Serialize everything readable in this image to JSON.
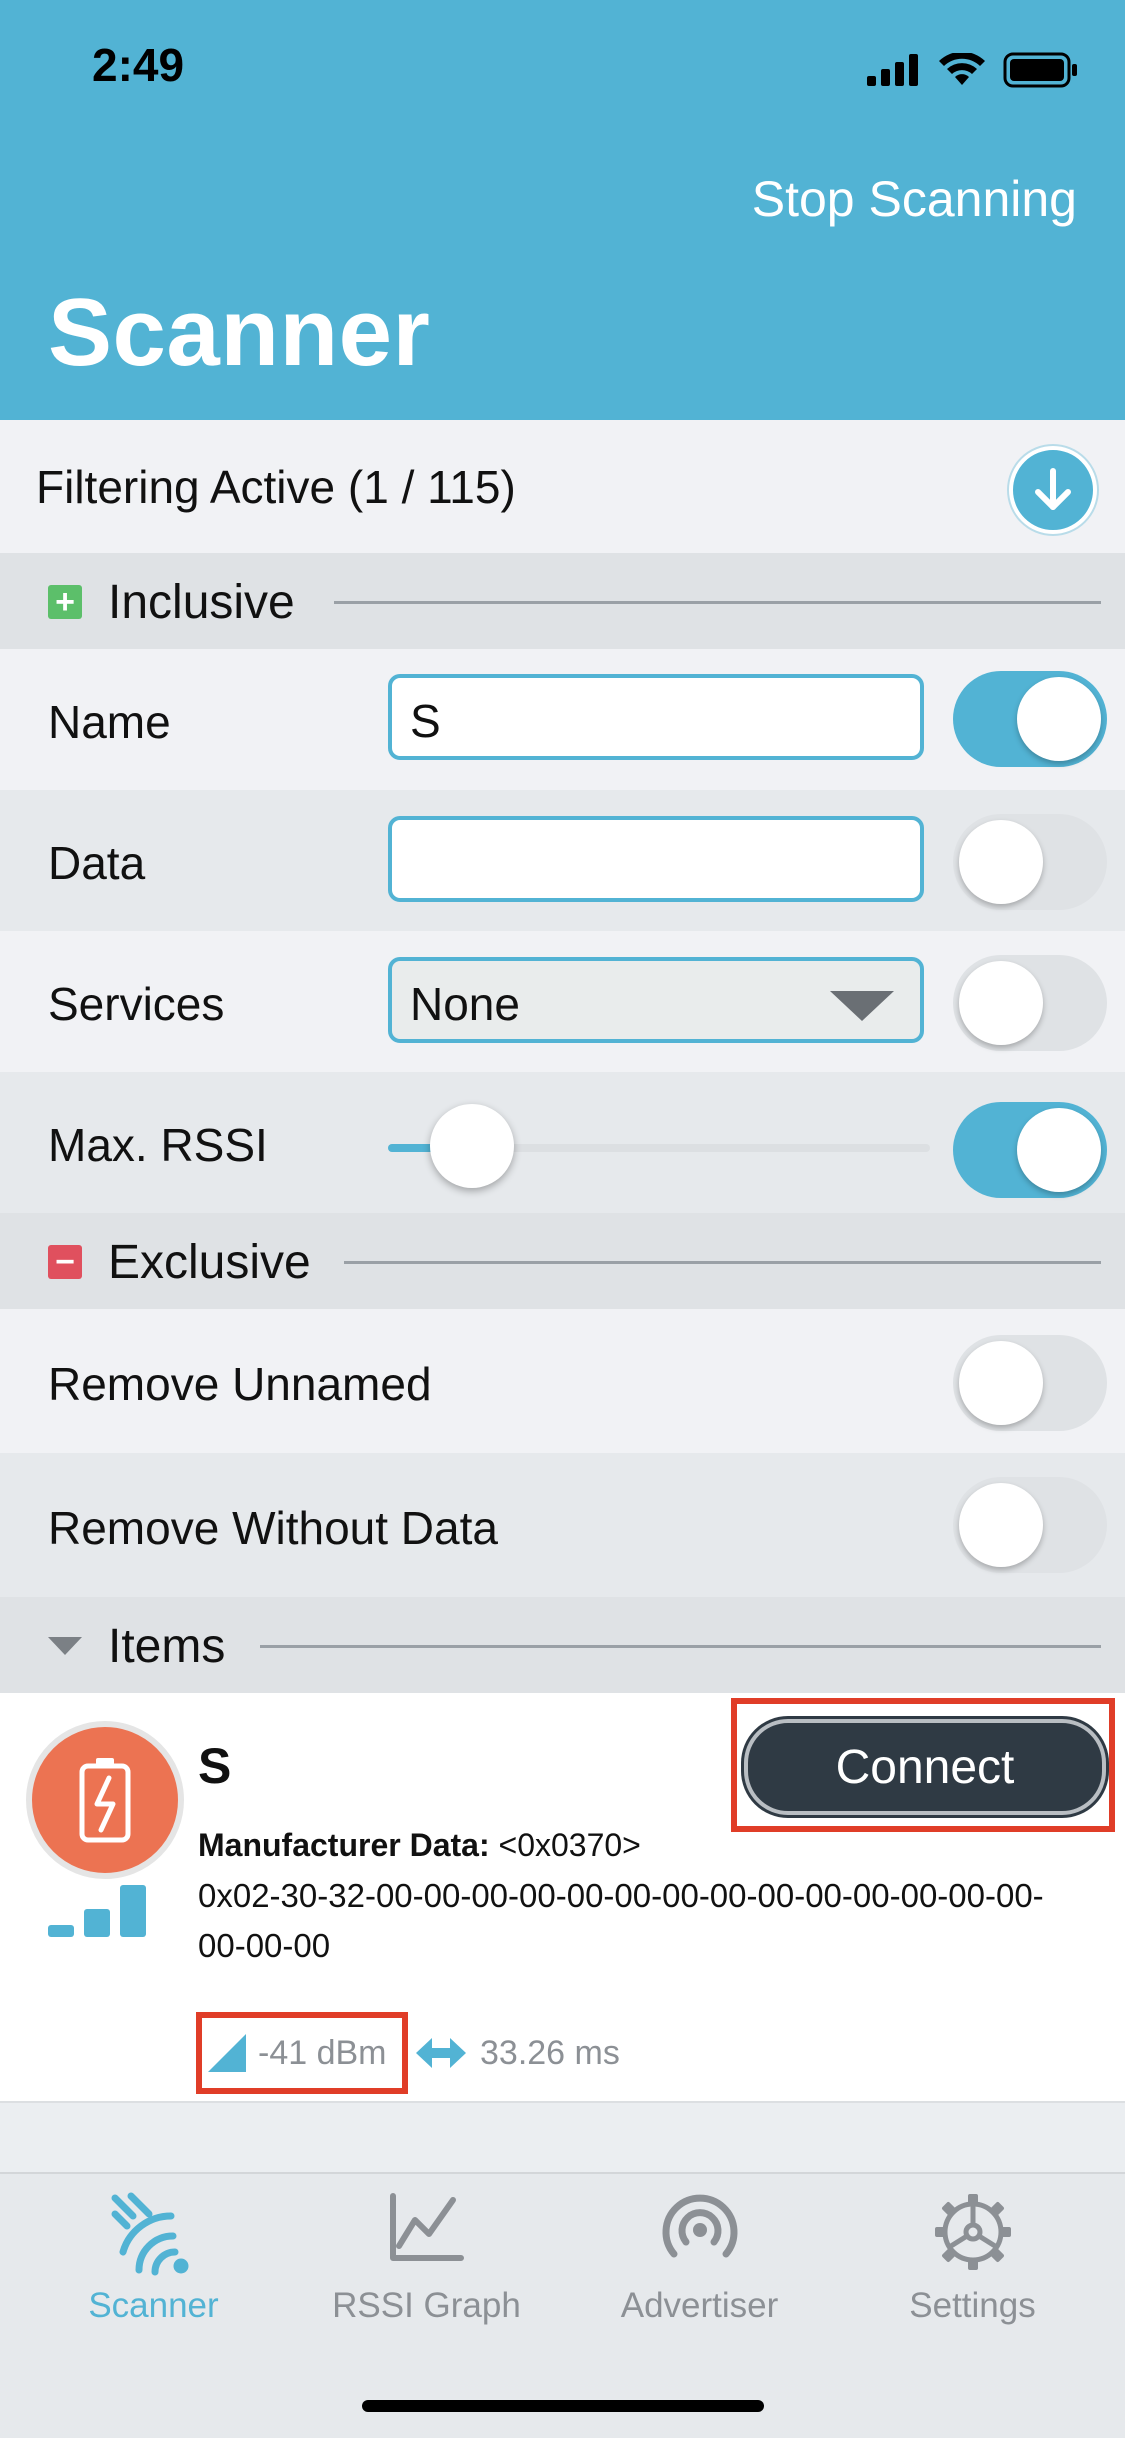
{
  "status_bar": {
    "time": "2:49"
  },
  "header": {
    "stop_scanning_label": "Stop Scanning",
    "title": "Scanner"
  },
  "filter": {
    "label": "Filtering Active (1 / 115)"
  },
  "inclusive": {
    "title": "Inclusive",
    "name_label": "Name",
    "name_value": "S",
    "name_enabled": true,
    "data_label": "Data",
    "data_value": "",
    "data_enabled": false,
    "services_label": "Services",
    "services_value": "None",
    "services_enabled": false,
    "max_rssi_label": "Max. RSSI",
    "max_rssi_fraction": 0.1,
    "max_rssi_enabled": true
  },
  "exclusive": {
    "title": "Exclusive",
    "remove_unnamed_label": "Remove Unnamed",
    "remove_unnamed_enabled": false,
    "remove_without_data_label": "Remove Without Data",
    "remove_without_data_enabled": false
  },
  "items": {
    "title": "Items",
    "devices": [
      {
        "name": "S",
        "connect_label": "Connect",
        "manufacturer_label": "Manufacturer Data:",
        "manufacturer_id": "<0x0370>",
        "manufacturer_bytes": "0x02-30-32-00-00-00-00-00-00-00-00-00-00-00-00-00-00-00-00-00",
        "rssi": "-41 dBm",
        "interval": "33.26 ms"
      }
    ]
  },
  "tabs": [
    {
      "label": "Scanner",
      "icon": "scanner-icon",
      "active": true
    },
    {
      "label": "RSSI Graph",
      "icon": "graph-icon",
      "active": false
    },
    {
      "label": "Advertiser",
      "icon": "broadcast-icon",
      "active": false
    },
    {
      "label": "Settings",
      "icon": "gear-icon",
      "active": false
    }
  ],
  "colors": {
    "accent": "#52b3d4",
    "inclusive_marker": "#5cbf6a",
    "exclusive_marker": "#e0505e",
    "device_avatar": "#ec7352",
    "highlight": "#e03d28",
    "inactive_tab": "#8c9095"
  }
}
